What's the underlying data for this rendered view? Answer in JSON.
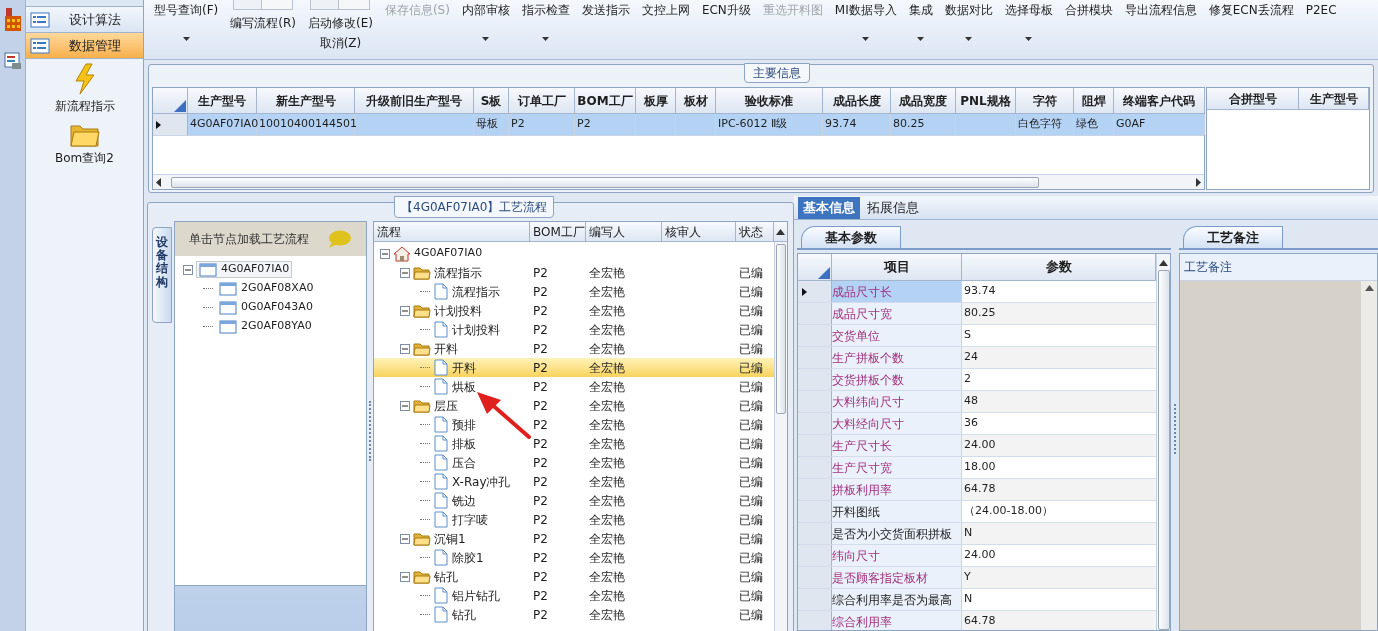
{
  "sidebar": {
    "items": [
      {
        "label": "设计算法",
        "selected": false
      },
      {
        "label": "数据管理",
        "selected": true
      }
    ],
    "shortcuts": [
      {
        "label": "新流程指示",
        "kind": "lightning"
      },
      {
        "label": "Bom查询2",
        "kind": "folder"
      }
    ]
  },
  "toolbar": [
    {
      "label": "型号查询(F)",
      "kind": "text",
      "dropdown": true,
      "disabled": false
    },
    {
      "label": "编写流程(R)",
      "kind": "large",
      "dropdown": false,
      "disabled": false
    },
    {
      "label": "启动修改(E)",
      "sub_label": "取消(Z)",
      "kind": "large",
      "dropdown": false,
      "disabled": false
    },
    {
      "label": "保存信息(S)",
      "kind": "text",
      "dropdown": false,
      "disabled": true
    },
    {
      "label": "内部审核",
      "kind": "text",
      "dropdown": true,
      "disabled": false
    },
    {
      "label": "指示检查",
      "kind": "text",
      "dropdown": true,
      "disabled": false
    },
    {
      "label": "发送指示",
      "kind": "text",
      "dropdown": false,
      "disabled": false
    },
    {
      "label": "文控上网",
      "kind": "text",
      "dropdown": false,
      "disabled": false
    },
    {
      "label": "ECN升级",
      "kind": "text",
      "dropdown": false,
      "disabled": false
    },
    {
      "label": "重选开料图",
      "kind": "text",
      "dropdown": false,
      "disabled": true
    },
    {
      "label": "MI数据导入",
      "kind": "text",
      "dropdown": true,
      "disabled": false
    },
    {
      "label": "集成",
      "kind": "text",
      "dropdown": true,
      "disabled": false
    },
    {
      "label": "数据对比",
      "kind": "text",
      "dropdown": true,
      "disabled": false
    },
    {
      "label": "选择母板",
      "kind": "text",
      "dropdown": true,
      "disabled": false
    },
    {
      "label": "合拼模块",
      "kind": "text",
      "dropdown": false,
      "disabled": false
    },
    {
      "label": "导出流程信息",
      "kind": "text",
      "dropdown": false,
      "disabled": false
    },
    {
      "label": "修复ECN丢流程",
      "kind": "text",
      "dropdown": false,
      "disabled": false
    },
    {
      "label": "P2EC",
      "kind": "text",
      "dropdown": false,
      "disabled": false
    }
  ],
  "main_info": {
    "title": "主要信息",
    "columns": [
      "生产型号",
      "新生产型号",
      "升级前旧生产型号",
      "S板",
      "订单工厂",
      "BOM工厂",
      "板厚",
      "板材",
      "验收标准",
      "成品长度",
      "成品宽度",
      "PNL规格",
      "字符",
      "阻焊",
      "终端客户代码"
    ],
    "rows": [
      {
        "selected": true,
        "cells": [
          "4G0AF07IA0",
          "10010400144501",
          null,
          "母板",
          "P2",
          "P2",
          null,
          null,
          "IPC-6012 Ⅱ级",
          "93.74",
          "80.25",
          null,
          "白色字符",
          "绿色",
          "G0AF"
        ]
      }
    ]
  },
  "merge_table": {
    "columns": [
      "合拼型号",
      "生产型号"
    ]
  },
  "process": {
    "title": "【4G0AF07IA0】工艺流程",
    "side_tab": "设备结构",
    "hint": "单击节点加载工艺流程",
    "structure_tree": [
      {
        "label": "4G0AF07IA0",
        "selected": true,
        "expanded": true,
        "children": [
          {
            "label": "2G0AF08XA0",
            "selected": false
          },
          {
            "label": "0G0AF043A0",
            "selected": false
          },
          {
            "label": "2G0AF08YA0",
            "selected": false
          }
        ]
      }
    ],
    "flow": {
      "columns": [
        "流程",
        "BOM工厂",
        "编写人",
        "核审人",
        "状态"
      ],
      "rows": [
        {
          "label": "4G0AF07IA0",
          "kind": "root",
          "selected": false,
          "expanded": true,
          "children": [
            {
              "label": "流程指示",
              "kind": "folder",
              "factory": "P2",
              "writer": "全宏艳",
              "status": "已编",
              "selected": false,
              "expanded": true,
              "children": [
                {
                  "label": "流程指示",
                  "kind": "step",
                  "factory": "P2",
                  "writer": "全宏艳",
                  "status": "已编",
                  "selected": false
                }
              ]
            },
            {
              "label": "计划投料",
              "kind": "folder",
              "factory": "P2",
              "writer": "全宏艳",
              "status": "已编",
              "selected": false,
              "expanded": true,
              "children": [
                {
                  "label": "计划投料",
                  "kind": "step",
                  "factory": "P2",
                  "writer": "全宏艳",
                  "status": "已编",
                  "selected": false
                }
              ]
            },
            {
              "label": "开料",
              "kind": "folder",
              "factory": "P2",
              "writer": "全宏艳",
              "status": "已编",
              "selected": false,
              "expanded": true,
              "children": [
                {
                  "label": "开料",
                  "kind": "step",
                  "factory": "P2",
                  "writer": "全宏艳",
                  "status": "已编",
                  "selected": true
                },
                {
                  "label": "烘板",
                  "kind": "step",
                  "factory": "P2",
                  "writer": "全宏艳",
                  "status": "已编",
                  "selected": false
                }
              ]
            },
            {
              "label": "层压",
              "kind": "folder",
              "factory": "P2",
              "writer": "全宏艳",
              "status": "已编",
              "selected": false,
              "expanded": true,
              "children": [
                {
                  "label": "预排",
                  "kind": "step",
                  "factory": "P2",
                  "writer": "全宏艳",
                  "status": "已编",
                  "selected": false
                },
                {
                  "label": "排板",
                  "kind": "step",
                  "factory": "P2",
                  "writer": "全宏艳",
                  "status": "已编",
                  "selected": false
                },
                {
                  "label": "压合",
                  "kind": "step",
                  "factory": "P2",
                  "writer": "全宏艳",
                  "status": "已编",
                  "selected": false
                },
                {
                  "label": "X-Ray冲孔",
                  "kind": "step",
                  "factory": "P2",
                  "writer": "全宏艳",
                  "status": "已编",
                  "selected": false
                },
                {
                  "label": "铣边",
                  "kind": "step",
                  "factory": "P2",
                  "writer": "全宏艳",
                  "status": "已编",
                  "selected": false
                },
                {
                  "label": "打字唛",
                  "kind": "step",
                  "factory": "P2",
                  "writer": "全宏艳",
                  "status": "已编",
                  "selected": false
                }
              ]
            },
            {
              "label": "沉铜1",
              "kind": "folder",
              "factory": "P2",
              "writer": "全宏艳",
              "status": "已编",
              "selected": false,
              "expanded": true,
              "children": [
                {
                  "label": "除胶1",
                  "kind": "step",
                  "factory": "P2",
                  "writer": "全宏艳",
                  "status": "已编",
                  "selected": false
                }
              ]
            },
            {
              "label": "钻孔",
              "kind": "folder",
              "factory": "P2",
              "writer": "全宏艳",
              "status": "已编",
              "selected": false,
              "expanded": true,
              "children": [
                {
                  "label": "铝片钻孔",
                  "kind": "step",
                  "factory": "P2",
                  "writer": "全宏艳",
                  "status": "已编",
                  "selected": false
                },
                {
                  "label": "钻孔",
                  "kind": "step",
                  "factory": "P2",
                  "writer": "全宏艳",
                  "status": "已编",
                  "selected": false
                }
              ]
            }
          ]
        }
      ]
    }
  },
  "details": {
    "tabs": [
      {
        "label": "基本信息",
        "selected": true
      },
      {
        "label": "拓展信息",
        "selected": false
      }
    ],
    "params": {
      "tab": "基本参数",
      "columns": [
        "项目",
        "参数"
      ],
      "rows": [
        {
          "item": "成品尺寸长",
          "value": "93.74",
          "emphasized": true,
          "selected": true
        },
        {
          "item": "成品尺寸宽",
          "value": "80.25",
          "emphasized": true,
          "selected": false
        },
        {
          "item": "交货单位",
          "value": "S",
          "emphasized": true,
          "selected": false
        },
        {
          "item": "生产拼板个数",
          "value": "24",
          "emphasized": true,
          "selected": false
        },
        {
          "item": "交货拼板个数",
          "value": "2",
          "emphasized": true,
          "selected": false
        },
        {
          "item": "大料纬向尺寸",
          "value": "48",
          "emphasized": true,
          "selected": false
        },
        {
          "item": "大料经向尺寸",
          "value": "36",
          "emphasized": true,
          "selected": false
        },
        {
          "item": "生产尺寸长",
          "value": "24.00",
          "emphasized": true,
          "selected": false
        },
        {
          "item": "生产尺寸宽",
          "value": "18.00",
          "emphasized": true,
          "selected": false
        },
        {
          "item": "拼板利用率",
          "value": "64.78",
          "emphasized": true,
          "selected": false
        },
        {
          "item": "开料图纸",
          "value": "（24.00-18.00）",
          "emphasized": false,
          "selected": false
        },
        {
          "item": "是否为小交货面积拼板",
          "value": "N",
          "emphasized": false,
          "selected": false
        },
        {
          "item": "纬向尺寸",
          "value": "24.00",
          "emphasized": true,
          "selected": false
        },
        {
          "item": "是否顾客指定板材",
          "value": "Y",
          "emphasized": true,
          "selected": false
        },
        {
          "item": "综合利用率是否为最高",
          "value": "N",
          "emphasized": false,
          "selected": false
        },
        {
          "item": "综合利用率",
          "value": "64.78",
          "emphasized": true,
          "selected": false
        }
      ]
    },
    "notes": {
      "tab": "工艺备注",
      "label": "工艺备注"
    }
  }
}
